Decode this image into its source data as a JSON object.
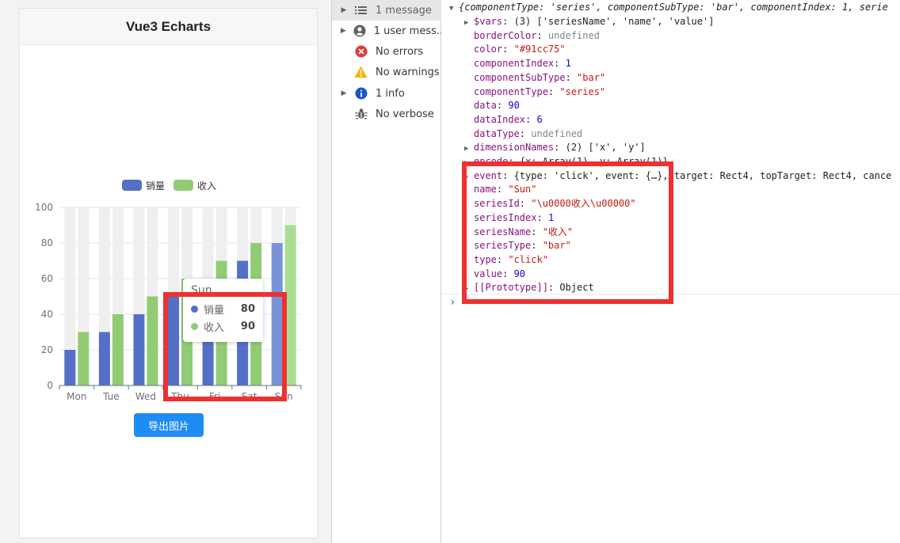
{
  "app": {
    "title": "Vue3 Echarts",
    "export_label": "导出图片"
  },
  "chart_data": {
    "type": "bar",
    "categories": [
      "Mon",
      "Tue",
      "Wed",
      "Thu",
      "Fri",
      "Sat",
      "Sun"
    ],
    "series": [
      {
        "name": "销量",
        "values": [
          20,
          30,
          40,
          50,
          60,
          70,
          80
        ],
        "color": "#5470c6"
      },
      {
        "name": "收入",
        "values": [
          30,
          40,
          50,
          60,
          70,
          80,
          90
        ],
        "color": "#91cc75"
      }
    ],
    "ylim": [
      0,
      100
    ],
    "yticks": [
      0,
      20,
      40,
      60,
      80,
      100
    ],
    "background_bar_color": "#efefef",
    "legend_position": "top-center",
    "tooltip": {
      "title": "Sun",
      "rows": [
        {
          "name": "销量",
          "value": "80",
          "color": "#5470c6"
        },
        {
          "name": "收入",
          "value": "90",
          "color": "#91cc75"
        }
      ]
    }
  },
  "sidebar": {
    "items": [
      {
        "label": "1 message",
        "icon": "list-icon",
        "expandable": true,
        "selected": true
      },
      {
        "label": "1 user mess...",
        "icon": "user-icon",
        "expandable": true,
        "selected": false
      },
      {
        "label": "No errors",
        "icon": "error-icon",
        "expandable": false,
        "selected": false
      },
      {
        "label": "No warnings",
        "icon": "warning-icon",
        "expandable": false,
        "selected": false
      },
      {
        "label": "1 info",
        "icon": "info-icon",
        "expandable": true,
        "selected": false
      },
      {
        "label": "No verbose",
        "icon": "bug-icon",
        "expandable": false,
        "selected": false
      }
    ]
  },
  "console": {
    "header": "{componentType: 'series', componentSubType: 'bar', componentIndex: 1, serie",
    "props": [
      {
        "key": "$vars",
        "value": "(3) ['seriesName', 'name', 'value']",
        "expandable": true,
        "vtype": "plain"
      },
      {
        "key": "borderColor",
        "value": "undefined",
        "expandable": false,
        "vtype": "undef"
      },
      {
        "key": "color",
        "value": "\"#91cc75\"",
        "expandable": false,
        "vtype": "str"
      },
      {
        "key": "componentIndex",
        "value": "1",
        "expandable": false,
        "vtype": "num"
      },
      {
        "key": "componentSubType",
        "value": "\"bar\"",
        "expandable": false,
        "vtype": "str"
      },
      {
        "key": "componentType",
        "value": "\"series\"",
        "expandable": false,
        "vtype": "str"
      },
      {
        "key": "data",
        "value": "90",
        "expandable": false,
        "vtype": "num"
      },
      {
        "key": "dataIndex",
        "value": "6",
        "expandable": false,
        "vtype": "num"
      },
      {
        "key": "dataType",
        "value": "undefined",
        "expandable": false,
        "vtype": "undef"
      },
      {
        "key": "dimensionNames",
        "value": "(2) ['x', 'y']",
        "expandable": true,
        "vtype": "plain"
      },
      {
        "key": "encode",
        "value": "{x: Array(1), y: Array(1)}",
        "expandable": true,
        "vtype": "plain"
      },
      {
        "key": "event",
        "value": "{type: 'click', event: {…}, target: Rect4, topTarget: Rect4, cance",
        "expandable": true,
        "vtype": "plain"
      },
      {
        "key": "name",
        "value": "\"Sun\"",
        "expandable": false,
        "vtype": "str"
      },
      {
        "key": "seriesId",
        "value": "\"\\u0000收入\\u00000\"",
        "expandable": false,
        "vtype": "str"
      },
      {
        "key": "seriesIndex",
        "value": "1",
        "expandable": false,
        "vtype": "num"
      },
      {
        "key": "seriesName",
        "value": "\"收入\"",
        "expandable": false,
        "vtype": "str"
      },
      {
        "key": "seriesType",
        "value": "\"bar\"",
        "expandable": false,
        "vtype": "str"
      },
      {
        "key": "type",
        "value": "\"click\"",
        "expandable": false,
        "vtype": "str"
      },
      {
        "key": "value",
        "value": "90",
        "expandable": false,
        "vtype": "num"
      },
      {
        "key": "[[Prototype]]",
        "value": "Object",
        "expandable": true,
        "vtype": "plain"
      }
    ],
    "prompt_symbol": "›"
  }
}
